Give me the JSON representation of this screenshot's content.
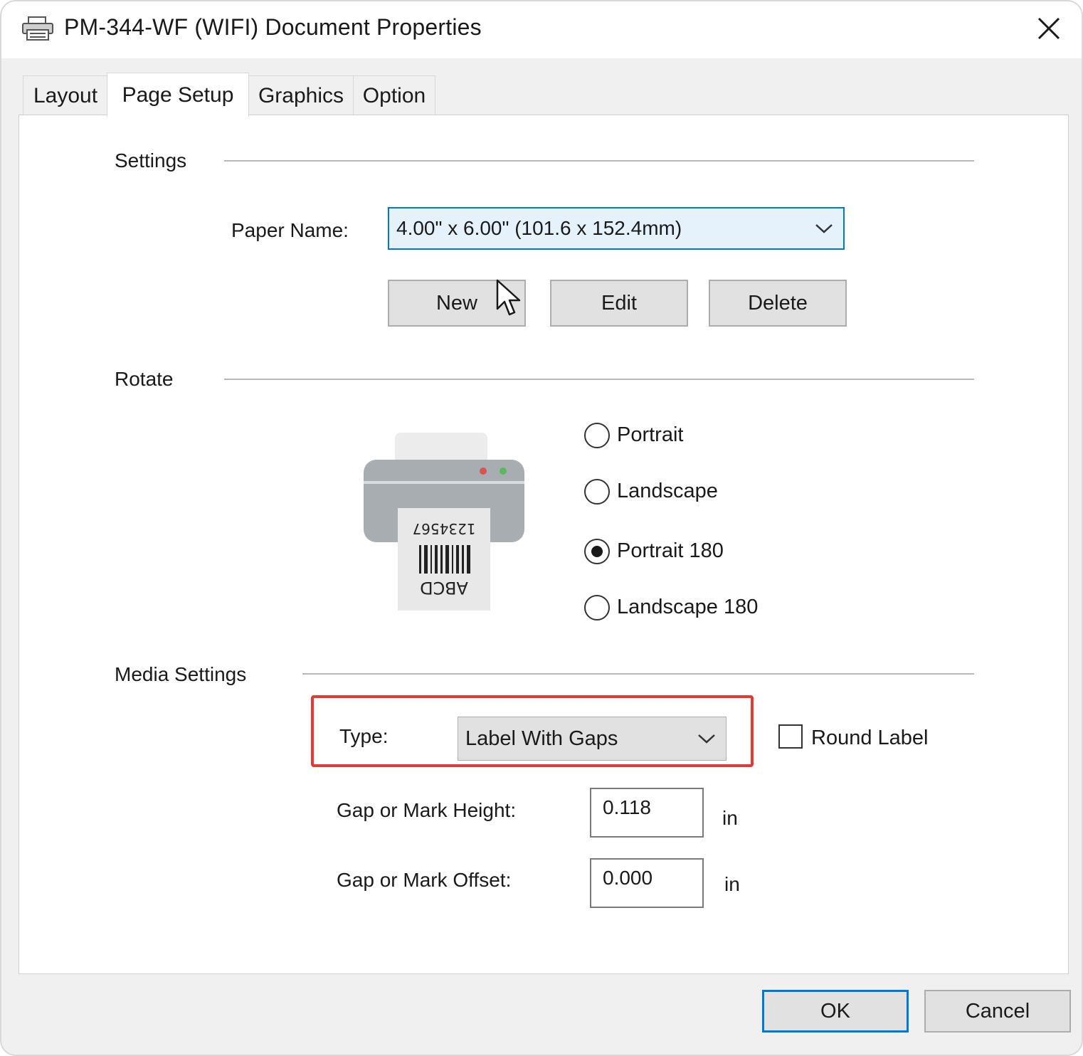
{
  "window": {
    "title": "PM-344-WF (WIFI) Document Properties",
    "icon": "printer-icon",
    "close": "close-icon"
  },
  "tabs": [
    {
      "label": "Layout",
      "active": false
    },
    {
      "label": "Page Setup",
      "active": true
    },
    {
      "label": "Graphics",
      "active": false
    },
    {
      "label": "Option",
      "active": false
    }
  ],
  "settings": {
    "group_label": "Settings",
    "paper_name_label": "Paper Name:",
    "paper_name_value": "4.00\" x 6.00\" (101.6 x 152.4mm)",
    "buttons": {
      "new": "New",
      "edit": "Edit",
      "delete": "Delete"
    }
  },
  "rotate": {
    "group_label": "Rotate",
    "options": [
      {
        "label": "Portrait",
        "checked": false
      },
      {
        "label": "Landscape",
        "checked": false
      },
      {
        "label": "Portrait 180",
        "checked": true
      },
      {
        "label": "Landscape 180",
        "checked": false
      }
    ],
    "preview": {
      "number_text": "1234567",
      "letters_text": "ABCD"
    }
  },
  "media": {
    "group_label": "Media Settings",
    "type_label": "Type:",
    "type_value": "Label With Gaps",
    "round_label": "Round Label",
    "round_checked": false,
    "gap_height_label": "Gap or Mark Height:",
    "gap_height_value": "0.118",
    "gap_height_unit": "in",
    "gap_offset_label": "Gap or Mark Offset:",
    "gap_offset_value": "0.000",
    "gap_offset_unit": "in",
    "highlight_color": "#e53935"
  },
  "footer": {
    "ok": "OK",
    "cancel": "Cancel"
  },
  "colors": {
    "accent": "#0078d7",
    "highlight": "#e53935"
  }
}
